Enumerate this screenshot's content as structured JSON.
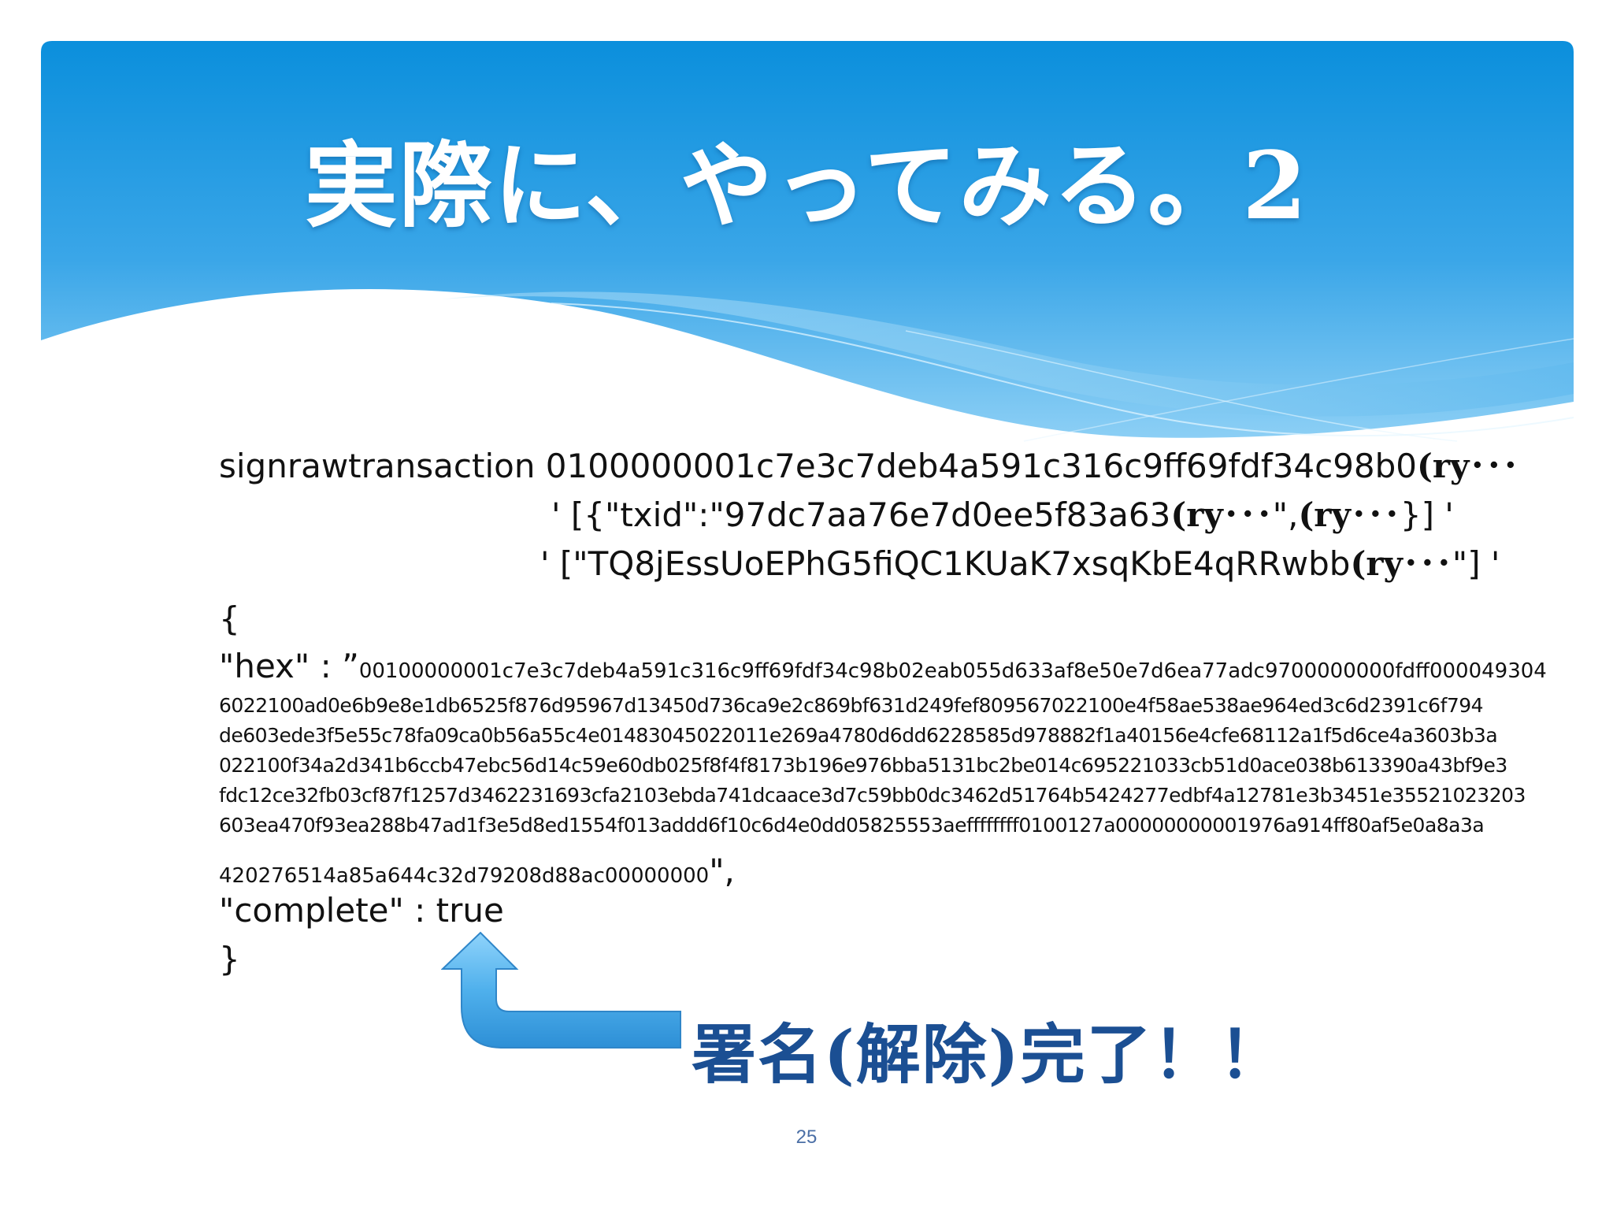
{
  "slide": {
    "title": "実際に、やってみる。2",
    "command": {
      "line1_text": "signrawtransaction 0100000001c7e3c7deb4a591c316c9ff69fdf34c98b0",
      "line1_suffix": "(ry･･･",
      "line2_prefix": "' [{\"txid\":\"97dc7aa76e7d0ee5f83a63",
      "line2_ry1": "(ry･･･",
      "line2_mid": "\",",
      "line2_ry2": "(ry･･･",
      "line2_suffix": "}] '",
      "line3_prefix": "' [\"TQ8jEssUoEPhG5fiQC1KUaK7xsqKbE4qRRwbb",
      "line3_ry": "(ry･･･",
      "line3_suffix": "\"] '"
    },
    "result": {
      "open_brace": "{",
      "hex_key": "\"hex\" : ”",
      "hex_lines": [
        "00100000001c7e3c7deb4a591c316c9ff69fdf34c98b02eab055d633af8e50e7d6ea77adc9700000000fdff000049304",
        "6022100ad0e6b9e8e1db6525f876d95967d13450d736ca9e2c869bf631d249fef809567022100e4f58ae538ae964ed3c6d2391c6f794",
        "de603ede3f5e55c78fa09ca0b56a55c4e01483045022011e269a4780d6dd6228585d978882f1a40156e4cfe68112a1f5d6ce4a3603b3a",
        "022100f34a2d341b6ccb47ebc56d14c59e60db025f8f4f8173b196e976bba5131bc2be014c695221033cb51d0ace038b613390a43bf9e3",
        "fdc12ce32fb03cf87f1257d3462231693cfa2103ebda741dcaace3d7c59bb0dc3462d51764b5424277edbf4a12781e3b3451e35521023203",
        "603ea470f93ea288b47ad1f3e5d8ed1554f013addd6f10c6d4e0dd05825553aeffffffff0100127a00000000001976a914ff80af5e0a8a3a",
        "420276514a85a644c32d79208d88ac00000000"
      ],
      "hex_close": "\",",
      "complete_line": "\"complete\" : true",
      "close_brace": "}"
    },
    "callout": "署名(解除)完了！！",
    "page_number": "25",
    "colors": {
      "banner_top": "#0b8fdc",
      "banner_bottom": "#7cc8f3",
      "callout": "#1b4f93",
      "arrow": "#4fb0ec"
    },
    "icons": {
      "arrow": "up-turn-arrow-icon"
    }
  }
}
